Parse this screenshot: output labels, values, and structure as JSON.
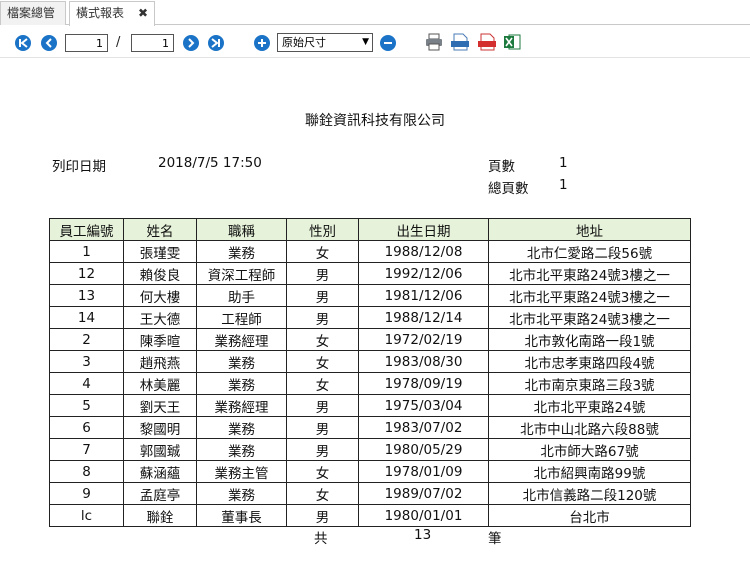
{
  "tabs": [
    {
      "label": "檔案總管"
    },
    {
      "label": "橫式報表",
      "close": "✖"
    }
  ],
  "toolbar": {
    "current_page": "1",
    "separator": "/",
    "total_pages": "1",
    "zoom": "原始尺寸",
    "icons": [
      "first-page-icon",
      "prev-page-icon",
      "next-page-icon",
      "last-page-icon",
      "zoom-in-icon",
      "zoom-out-icon",
      "print-icon",
      "xml-export-icon",
      "pdf-export-icon",
      "excel-export-icon"
    ],
    "accent": "#1a73c7"
  },
  "report": {
    "company": "聯銓資訊科技有限公司",
    "print_date_label": "列印日期",
    "print_date_value": "2018/7/5 17:50",
    "page_label": "頁數",
    "page_value": "1",
    "total_pages_label": "總頁數",
    "total_pages_value": "1",
    "columns": [
      "員工編號",
      "姓名",
      "職稱",
      "性別",
      "出生日期",
      "地址"
    ],
    "rows": [
      [
        "1",
        "張瑾雯",
        "業務",
        "女",
        "1988/12/08",
        "北市仁愛路二段56號"
      ],
      [
        "12",
        "賴俊良",
        "資深工程師",
        "男",
        "1992/12/06",
        "北市北平東路24號3樓之一"
      ],
      [
        "13",
        "何大樓",
        "助手",
        "男",
        "1981/12/06",
        "北市北平東路24號3樓之一"
      ],
      [
        "14",
        "王大德",
        "工程師",
        "男",
        "1988/12/14",
        "北市北平東路24號3樓之一"
      ],
      [
        "2",
        "陳季暄",
        "業務經理",
        "女",
        "1972/02/19",
        "北市敦化南路一段1號"
      ],
      [
        "3",
        "趙飛燕",
        "業務",
        "女",
        "1983/08/30",
        "北市忠孝東路四段4號"
      ],
      [
        "4",
        "林美麗",
        "業務",
        "女",
        "1978/09/19",
        "北市南京東路三段3號"
      ],
      [
        "5",
        "劉天王",
        "業務經理",
        "男",
        "1975/03/04",
        "北市北平東路24號"
      ],
      [
        "6",
        "黎國明",
        "業務",
        "男",
        "1983/07/02",
        "北市中山北路六段88號"
      ],
      [
        "7",
        "郭國臹",
        "業務",
        "男",
        "1980/05/29",
        "北市師大路67號"
      ],
      [
        "8",
        "蘇涵蘊",
        "業務主管",
        "女",
        "1978/01/09",
        "北市紹興南路99號"
      ],
      [
        "9",
        "孟庭亭",
        "業務",
        "女",
        "1989/07/02",
        "北市信義路二段120號"
      ],
      [
        "lc",
        "聯銓",
        "董事長",
        "男",
        "1980/01/01",
        "台北市"
      ]
    ],
    "footer_prefix": "共",
    "footer_count": "13",
    "footer_suffix": "筆",
    "header_bg": "#e6f2d9"
  }
}
